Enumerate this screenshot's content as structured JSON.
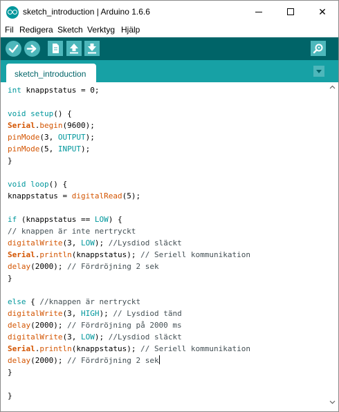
{
  "window": {
    "title": "sketch_introduction | Arduino 1.6.6",
    "minimize_glyph": "",
    "close_glyph": "✕"
  },
  "menu": [
    "Fil",
    "Redigera",
    "Sketch",
    "Verktyg",
    "Hjälp"
  ],
  "toolbar": {
    "buttons": [
      "verify-icon",
      "upload-icon",
      "new-icon",
      "open-icon",
      "save-icon",
      "serial-monitor-icon"
    ],
    "accent": "#006468",
    "button_color": "#4db7bb"
  },
  "tabs": [
    {
      "label": "sketch_introduction"
    }
  ],
  "editor": {
    "lines": [
      [
        {
          "t": "keyword",
          "s": "int"
        },
        {
          "t": "plain",
          "s": " knappstatus = 0;"
        }
      ],
      [],
      [
        {
          "t": "keyword",
          "s": "void"
        },
        {
          "t": "plain",
          "s": " "
        },
        {
          "t": "keyword",
          "s": "setup"
        },
        {
          "t": "plain",
          "s": "() {"
        }
      ],
      [
        {
          "t": "serial",
          "s": "Serial"
        },
        {
          "t": "plain",
          "s": "."
        },
        {
          "t": "function",
          "s": "begin"
        },
        {
          "t": "plain",
          "s": "(9600);"
        }
      ],
      [
        {
          "t": "function",
          "s": "pinMode"
        },
        {
          "t": "plain",
          "s": "(3, "
        },
        {
          "t": "constant",
          "s": "OUTPUT"
        },
        {
          "t": "plain",
          "s": ");"
        }
      ],
      [
        {
          "t": "function",
          "s": "pinMode"
        },
        {
          "t": "plain",
          "s": "(5, "
        },
        {
          "t": "constant",
          "s": "INPUT"
        },
        {
          "t": "plain",
          "s": ");"
        }
      ],
      [
        {
          "t": "plain",
          "s": "}"
        }
      ],
      [],
      [
        {
          "t": "keyword",
          "s": "void"
        },
        {
          "t": "plain",
          "s": " "
        },
        {
          "t": "keyword",
          "s": "loop"
        },
        {
          "t": "plain",
          "s": "() {"
        }
      ],
      [
        {
          "t": "plain",
          "s": "knappstatus = "
        },
        {
          "t": "function",
          "s": "digitalRead"
        },
        {
          "t": "plain",
          "s": "(5);"
        }
      ],
      [],
      [
        {
          "t": "keyword",
          "s": "if"
        },
        {
          "t": "plain",
          "s": " (knappstatus == "
        },
        {
          "t": "constant",
          "s": "LOW"
        },
        {
          "t": "plain",
          "s": ") {"
        }
      ],
      [
        {
          "t": "comment",
          "s": "// knappen är inte nertryckt"
        }
      ],
      [
        {
          "t": "function",
          "s": "digitalWrite"
        },
        {
          "t": "plain",
          "s": "(3, "
        },
        {
          "t": "constant",
          "s": "LOW"
        },
        {
          "t": "plain",
          "s": "); "
        },
        {
          "t": "comment",
          "s": "//Lysdiod släckt"
        }
      ],
      [
        {
          "t": "serial",
          "s": "Serial"
        },
        {
          "t": "plain",
          "s": "."
        },
        {
          "t": "function",
          "s": "println"
        },
        {
          "t": "plain",
          "s": "(knappstatus); "
        },
        {
          "t": "comment",
          "s": "// Seriell kommunikation"
        }
      ],
      [
        {
          "t": "function",
          "s": "delay"
        },
        {
          "t": "plain",
          "s": "(2000); "
        },
        {
          "t": "comment",
          "s": "// Fördröjning 2 sek"
        }
      ],
      [
        {
          "t": "plain",
          "s": "}"
        }
      ],
      [],
      [
        {
          "t": "keyword",
          "s": "else"
        },
        {
          "t": "plain",
          "s": " { "
        },
        {
          "t": "comment",
          "s": "//knappen är nertryckt"
        }
      ],
      [
        {
          "t": "function",
          "s": "digitalWrite"
        },
        {
          "t": "plain",
          "s": "(3, "
        },
        {
          "t": "constant",
          "s": "HIGH"
        },
        {
          "t": "plain",
          "s": "); "
        },
        {
          "t": "comment",
          "s": "// Lysdiod tänd"
        }
      ],
      [
        {
          "t": "function",
          "s": "delay"
        },
        {
          "t": "plain",
          "s": "(2000); "
        },
        {
          "t": "comment",
          "s": "// Fördröjning på 2000 ms"
        }
      ],
      [
        {
          "t": "function",
          "s": "digitalWrite"
        },
        {
          "t": "plain",
          "s": "(3, "
        },
        {
          "t": "constant",
          "s": "LOW"
        },
        {
          "t": "plain",
          "s": "); "
        },
        {
          "t": "comment",
          "s": "//Lysdiod släckt"
        }
      ],
      [
        {
          "t": "serial",
          "s": "Serial"
        },
        {
          "t": "plain",
          "s": "."
        },
        {
          "t": "function",
          "s": "println"
        },
        {
          "t": "plain",
          "s": "(knappstatus); "
        },
        {
          "t": "comment",
          "s": "// Seriell kommunikation"
        }
      ],
      [
        {
          "t": "function",
          "s": "delay"
        },
        {
          "t": "plain",
          "s": "(2000); "
        },
        {
          "t": "comment",
          "s": "// Fördröjning 2 sek"
        },
        {
          "t": "caret",
          "s": ""
        }
      ],
      [
        {
          "t": "plain",
          "s": "}"
        }
      ],
      [],
      [
        {
          "t": "plain",
          "s": "}"
        }
      ]
    ],
    "colors": {
      "keyword": "#00979c",
      "function": "#d35400",
      "constant": "#00979c",
      "comment": "#434f54"
    }
  }
}
